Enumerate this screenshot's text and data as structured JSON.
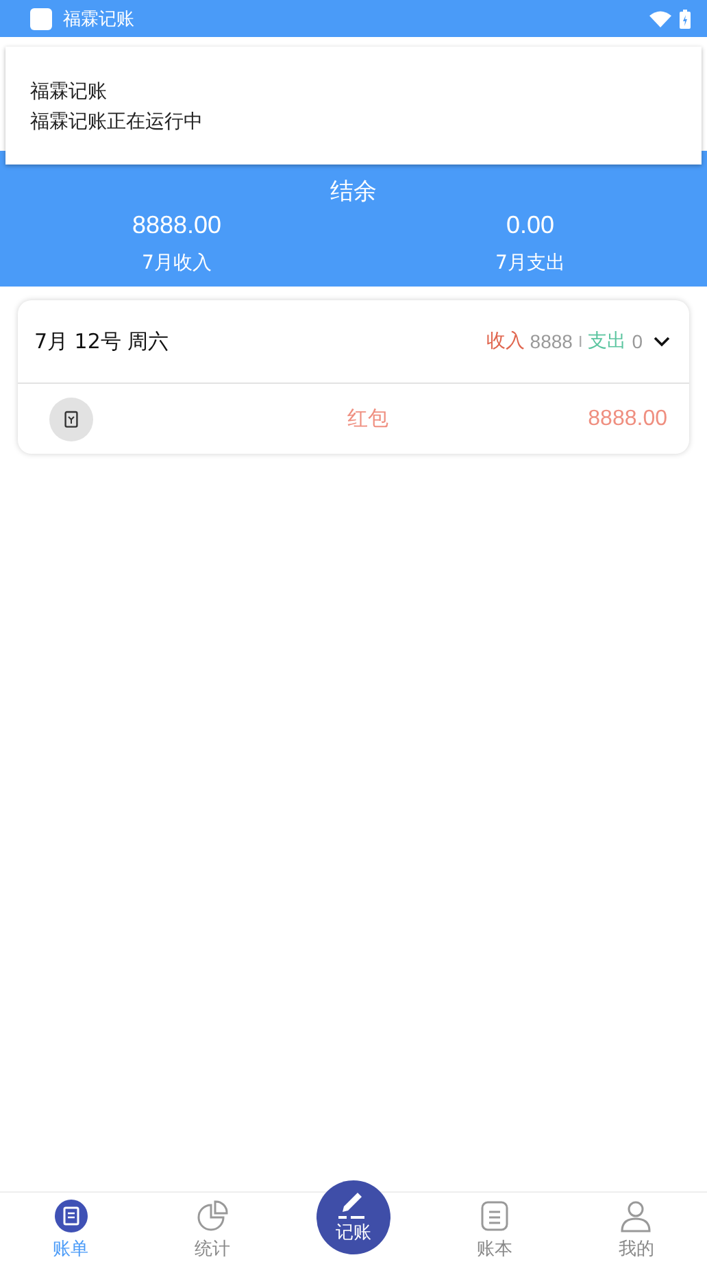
{
  "status_bar": {
    "app_name": "福霖记账"
  },
  "notification": {
    "title": "福霖记账",
    "text": "福霖记账正在运行中"
  },
  "summary": {
    "title": "结余",
    "items": [
      {
        "value": "8888.00",
        "label": "7月收入"
      },
      {
        "value": "0.00",
        "label": "7月支出"
      }
    ]
  },
  "days": [
    {
      "date": "7月 12号 周六",
      "income_label": "收入",
      "income": "8888",
      "separator": "I",
      "expense_label": "支出",
      "expense": "0",
      "expanded": true,
      "entries": [
        {
          "category": "红包",
          "amount": "8888.00"
        }
      ]
    }
  ],
  "nav": [
    {
      "kind": "list",
      "label": "账单",
      "selected": true
    },
    {
      "kind": "chart",
      "label": "统计",
      "selected": false
    },
    {
      "kind": "center",
      "label": "记账",
      "selected": false
    },
    {
      "kind": "book",
      "label": "账本",
      "selected": false
    },
    {
      "kind": "user",
      "label": "我的",
      "selected": false
    }
  ]
}
